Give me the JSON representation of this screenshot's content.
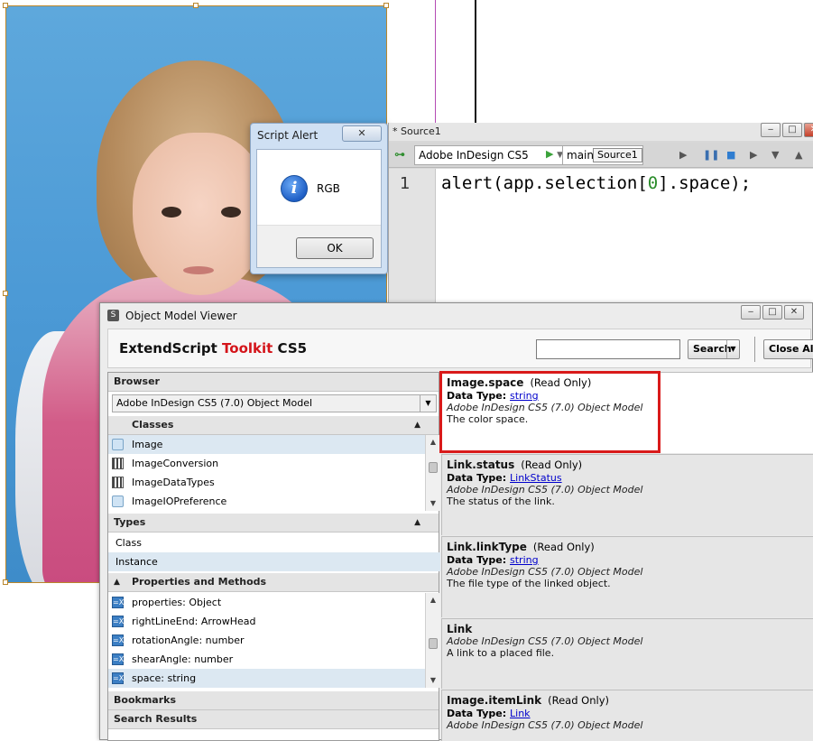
{
  "alert": {
    "title": "Script Alert",
    "close_label": "✕",
    "message": "RGB",
    "ok_label": "OK",
    "icon": "info-icon"
  },
  "source": {
    "title": "* Source1",
    "target_app": "Adobe InDesign CS5",
    "engine": "main",
    "tooltip": "Source1",
    "line_number": "1",
    "code": {
      "before": "alert(app.selection[",
      "num": "0",
      "after": "].space);"
    }
  },
  "omv": {
    "title": "Object Model Viewer",
    "brand": {
      "part1": "ExtendScript ",
      "part2": "Toolkit",
      "part3": " CS5"
    },
    "search_value": "",
    "search_label": "Search",
    "close_all_label": "Close All",
    "browser_label": "Browser",
    "model_selected": "Adobe InDesign CS5 (7.0) Object Model",
    "classes_label": "Classes",
    "classes": [
      {
        "label": "Image",
        "icon": "cube-icon"
      },
      {
        "label": "ImageConversion",
        "icon": "enum-icon"
      },
      {
        "label": "ImageDataTypes",
        "icon": "enum-icon"
      },
      {
        "label": "ImageIOPreference",
        "icon": "cube-icon"
      }
    ],
    "types_label": "Types",
    "types": [
      "Class",
      "Instance"
    ],
    "props_label": "Properties and Methods",
    "props": [
      "properties: Object",
      "rightLineEnd: ArrowHead",
      "rotationAngle: number",
      "shearAngle: number",
      "space: string"
    ],
    "bookmarks_label": "Bookmarks",
    "search_results_label": "Search Results",
    "cards": [
      {
        "name": "Image.space",
        "ro": "(Read Only)",
        "dtype_label": "Data Type:",
        "dtype": "string",
        "model": "Adobe InDesign CS5 (7.0) Object Model",
        "desc": "The color space."
      },
      {
        "name": "Link.status",
        "ro": "(Read Only)",
        "dtype_label": "Data Type:",
        "dtype": "LinkStatus",
        "model": "Adobe InDesign CS5 (7.0) Object Model",
        "desc": "The status of the link."
      },
      {
        "name": "Link.linkType",
        "ro": "(Read Only)",
        "dtype_label": "Data Type:",
        "dtype": "string",
        "model": "Adobe InDesign CS5 (7.0) Object Model",
        "desc": "The file type of the linked object."
      },
      {
        "name": "Link",
        "ro": "",
        "dtype_label": "",
        "dtype": "",
        "model": "Adobe InDesign CS5 (7.0) Object Model",
        "desc": "A link to a placed file."
      },
      {
        "name": "Image.itemLink",
        "ro": "(Read Only)",
        "dtype_label": "Data Type:",
        "dtype": "Link",
        "model": "Adobe InDesign CS5 (7.0) Object Model",
        "desc": ""
      }
    ]
  },
  "colors": {
    "accent_red": "#d91a1a",
    "toolkit_red": "#d4141a",
    "link_blue": "#0000cc"
  }
}
